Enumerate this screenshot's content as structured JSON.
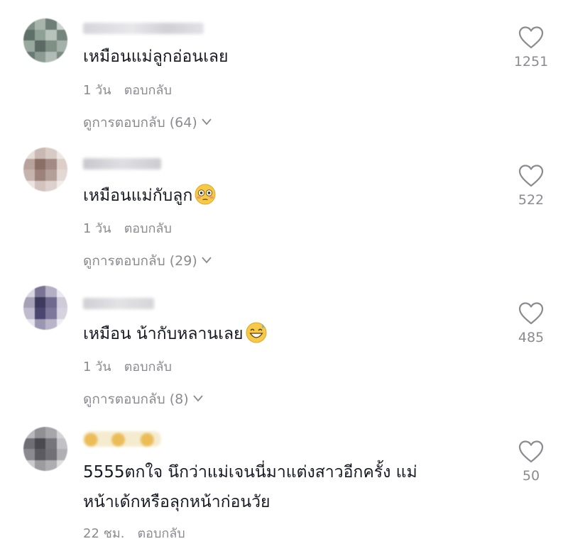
{
  "comments": [
    {
      "text": "เหมือนแม่ลูกอ่อนเลย",
      "time": "1 วัน",
      "reply_label": "ตอบกลับ",
      "view_replies": "ดูการตอบกลับ (64)",
      "likes": "1251",
      "emoji": ""
    },
    {
      "text": "เหมือนแม่กับลูก",
      "time": "1 วัน",
      "reply_label": "ตอบกลับ",
      "view_replies": "ดูการตอบกลับ (29)",
      "likes": "522",
      "emoji": "flushed-face"
    },
    {
      "text": "เหมือน น้ากับหลานเลย",
      "time": "1 วัน",
      "reply_label": "ตอบกลับ",
      "view_replies": "ดูการตอบกลับ (8)",
      "likes": "485",
      "emoji": "grinning-sweat-face"
    },
    {
      "text_line1": "5555ตกใจ นึกว่าแม่เจนนี่มาแต่งสาวอีกครั้ง แม่",
      "text_line2": "หน้าเด้กหรือลุกหน้าก่อนวัย",
      "time": "22 ชม.",
      "reply_label": "ตอบกลับ",
      "likes": "50",
      "emoji": ""
    }
  ],
  "icons": {
    "like": "heart-outline-icon",
    "expand": "chevron-down-icon"
  },
  "colors": {
    "text": "#161823",
    "muted": "#8a8b91",
    "background": "#ffffff"
  }
}
